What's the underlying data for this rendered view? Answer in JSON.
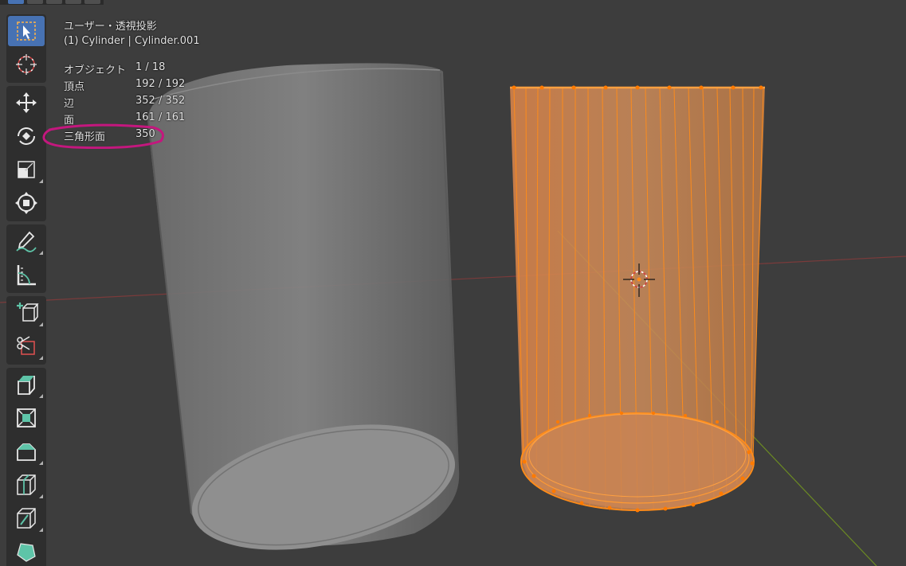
{
  "viewport": {
    "view_name": "ユーザー・透視投影",
    "active_object": "(1) Cylinder | Cylinder.001"
  },
  "stats": [
    {
      "label": "オブジェクト",
      "value": "1 / 18"
    },
    {
      "label": "頂点",
      "value": "192 / 192"
    },
    {
      "label": "辺",
      "value": "352 / 352"
    },
    {
      "label": "面",
      "value": "161 / 161"
    },
    {
      "label": "三角形面",
      "value": "350"
    }
  ],
  "toolbar": {
    "groups": [
      [
        "select-box-icon",
        "cursor-icon"
      ],
      [
        "move-icon",
        "rotate-icon",
        "scale-icon",
        "transform-icon"
      ],
      [
        "annotate-icon",
        "measure-icon"
      ],
      [
        "add-cube-icon",
        "bisect-icon"
      ],
      [
        "extrude-region-icon",
        "inset-faces-icon",
        "bevel-icon",
        "loop-cut-icon",
        "knife-icon",
        "poly-build-icon"
      ]
    ],
    "active_tool": "select-box-icon"
  },
  "colors": {
    "background": "#3d3d3d",
    "toolbar_bg": "#2e2e2e",
    "active_tool": "#4772b3",
    "selection_orange": "#ff8c1a",
    "highlight_ring": "#c4177e",
    "x_axis": "#7a3b3b",
    "y_axis": "#6b8a23"
  }
}
